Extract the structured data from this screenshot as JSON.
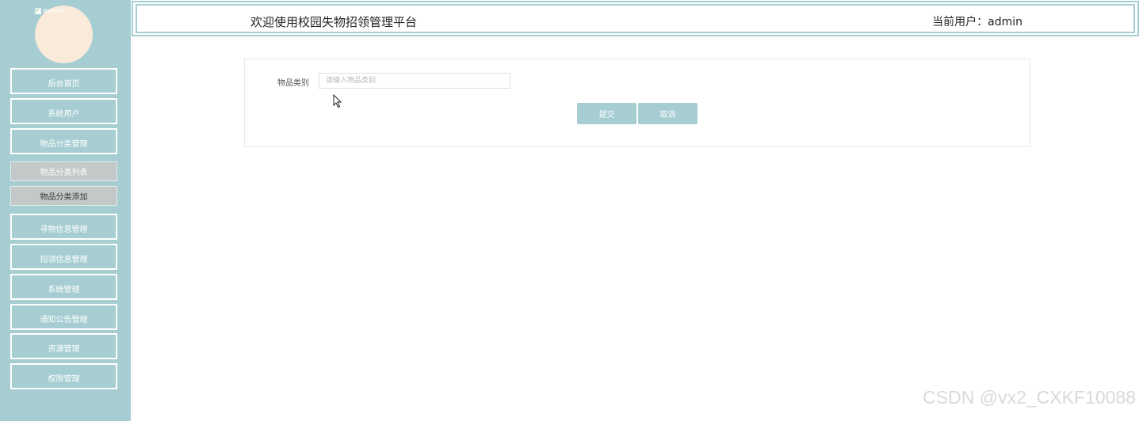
{
  "sidebar": {
    "avatar_alt": "avatar",
    "menu": {
      "home": "后台首页",
      "system_users": "系统用户",
      "category_mgmt": "物品分类管理",
      "category_list": "物品分类列表",
      "category_add": "物品分类添加",
      "lost_item_mgmt": "寻物信息管理",
      "found_item_mgmt": "招领信息管理",
      "system_mgmt": "系统管理",
      "notice_mgmt": "通知公告管理",
      "resource_mgmt": "资源管理",
      "permission_mgmt": "权限管理"
    }
  },
  "header": {
    "title": "欢迎使用校园失物招领管理平台",
    "current_user": "当前用户：admin"
  },
  "form": {
    "category_label": "物品类别",
    "category_value": "",
    "category_placeholder": "请输入物品类别",
    "submit_label": "提交",
    "cancel_label": "取消"
  },
  "watermark": "CSDN @vx2_CXKF10088",
  "colors": {
    "theme": "#a5cdd2",
    "submenu_bg": "#c3c8c8",
    "avatar_bg": "#f9ead9"
  },
  "icons": {
    "broken_image": "broken-image-icon",
    "cursor": "mouse-pointer-icon"
  }
}
